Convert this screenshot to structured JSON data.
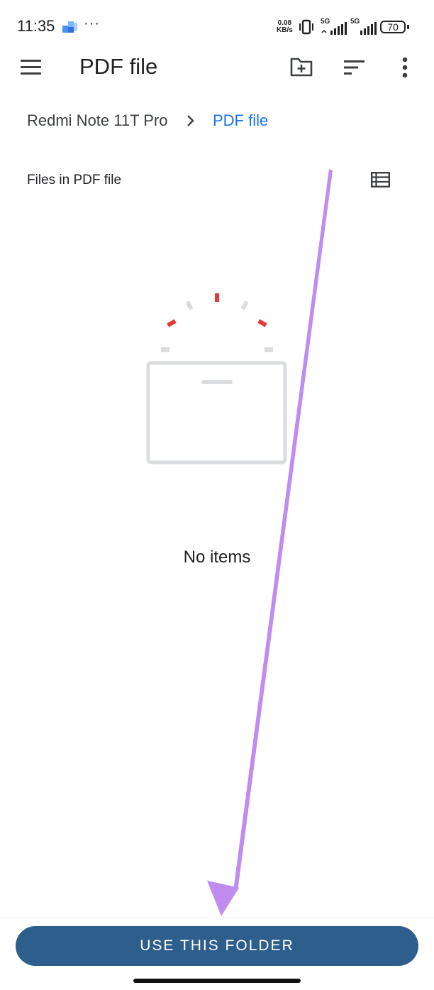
{
  "status_bar": {
    "time": "11:35",
    "more": "···",
    "net_speed_value": "0.08",
    "net_speed_unit": "KB/s",
    "signal_1_label": "5G",
    "signal_2_label": "5G",
    "battery": "70",
    "icons": [
      "app-notification-icon",
      "vibrate-icon",
      "signal-icon",
      "battery-icon"
    ]
  },
  "toolbar": {
    "title": "PDF file",
    "icons": [
      "menu-icon",
      "new-folder-icon",
      "sort-icon",
      "overflow-menu-icon"
    ]
  },
  "breadcrumb": {
    "root": "Redmi Note 11T Pro",
    "current": "PDF file"
  },
  "files_header": {
    "label": "Files in PDF file"
  },
  "empty_state": {
    "text": "No items"
  },
  "actions": {
    "use_folder_label": "USE THIS FOLDER"
  },
  "colors": {
    "accent": "#1a73e8",
    "button": "#2e5e8c",
    "arrow": "#c08cf0",
    "illustration_red": "#e53935"
  }
}
